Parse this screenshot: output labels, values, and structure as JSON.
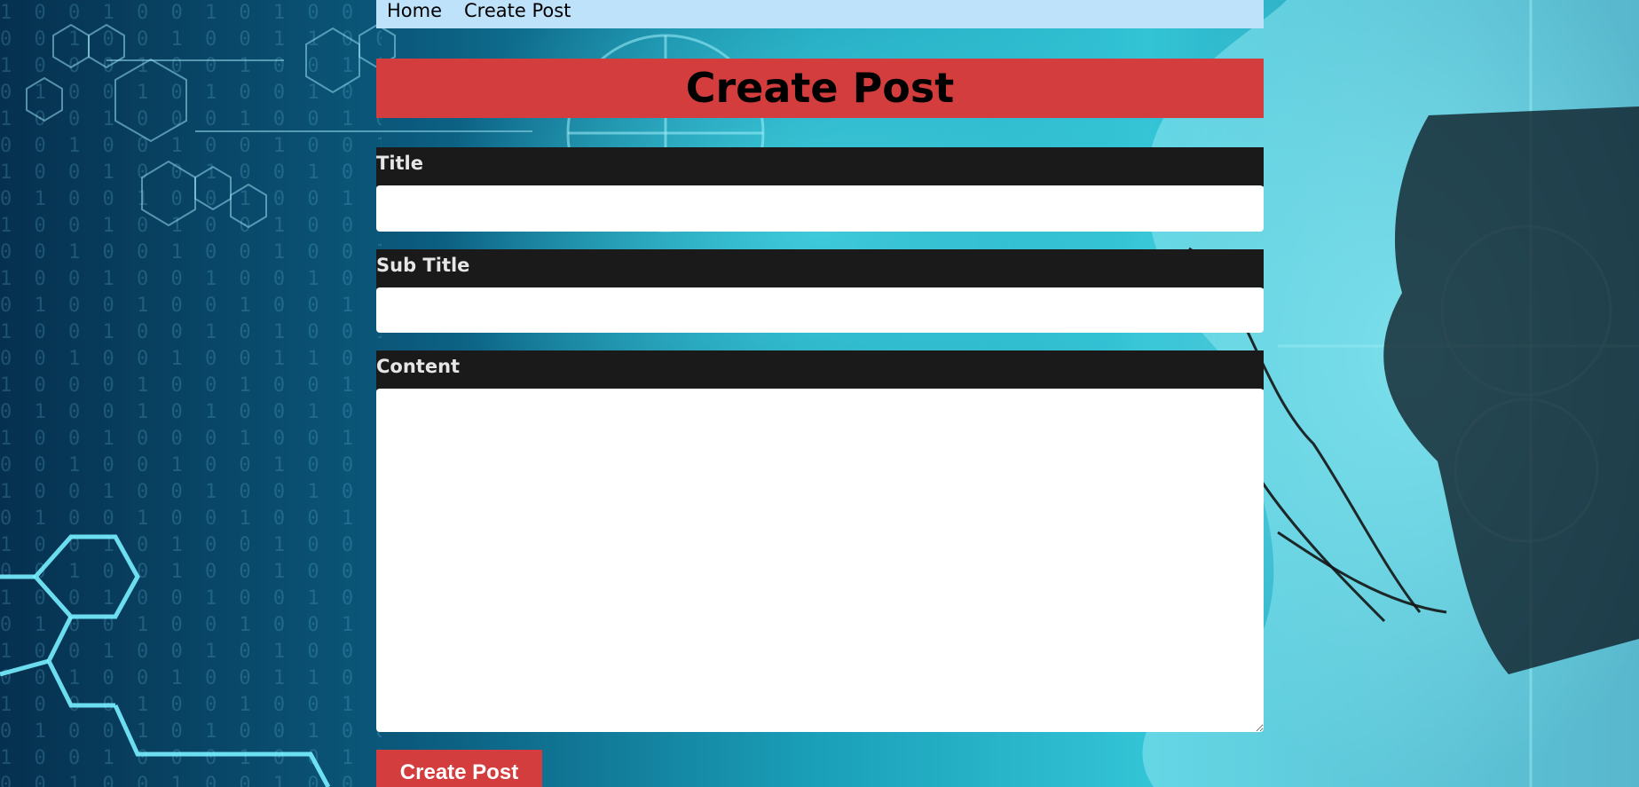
{
  "nav": {
    "home_label": "Home",
    "create_post_label": "Create Post"
  },
  "page": {
    "title": "Create Post"
  },
  "form": {
    "title_label": "Title",
    "title_value": "",
    "subtitle_label": "Sub Title",
    "subtitle_value": "",
    "content_label": "Content",
    "content_value": "",
    "submit_label": "Create Post"
  },
  "colors": {
    "nav_background": "#bfe2fb",
    "title_background": "#d43d3d",
    "label_background": "#1a1a1a",
    "button_background": "#d43d3d"
  }
}
